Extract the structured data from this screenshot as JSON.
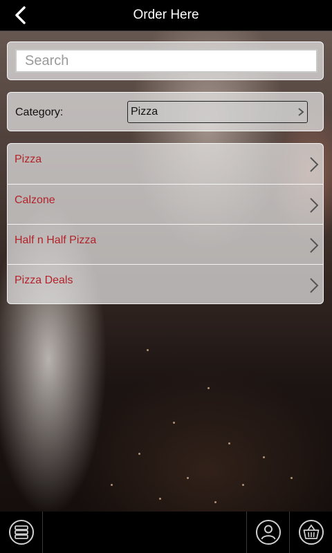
{
  "header": {
    "title": "Order Here",
    "back_icon": "chevron-left-icon"
  },
  "search": {
    "placeholder": "Search",
    "value": ""
  },
  "category": {
    "label": "Category:",
    "selected": "Pizza"
  },
  "menu_items": [
    {
      "label": "Pizza"
    },
    {
      "label": "Calzone"
    },
    {
      "label": "Half n Half Pizza"
    },
    {
      "label": "Pizza Deals"
    }
  ],
  "footer": {
    "icons": [
      "menu-list-icon",
      "user-account-icon",
      "shopping-basket-icon"
    ]
  },
  "colors": {
    "header_bg": "#000000",
    "item_text": "#b3232b",
    "panel_bg": "rgba(230,230,230,0.72)"
  }
}
